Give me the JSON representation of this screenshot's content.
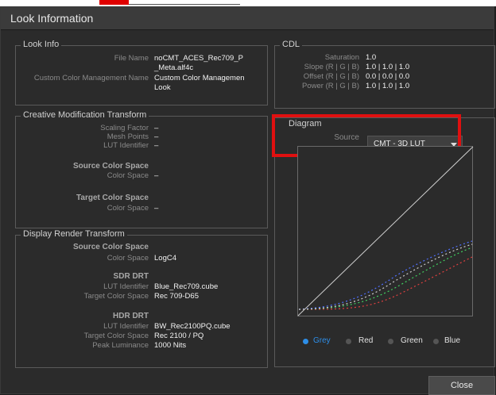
{
  "window_title": "Look Information",
  "look_info": {
    "title": "Look Info",
    "file_name_label": "File Name",
    "file_name_value": "noCMT_ACES_Rec709_P",
    "file_name_value2": "_Meta.alf4c",
    "ccm_label": "Custom Color Management Name",
    "ccm_value": "Custom Color Managemen",
    "ccm_value2": "Look"
  },
  "cmt": {
    "title": "Creative Modification Transform",
    "scaling_label": "Scaling Factor",
    "scaling_value": "–",
    "mesh_label": "Mesh Points",
    "mesh_value": "–",
    "lut_label": "LUT Identifier",
    "lut_value": "–",
    "source_heading": "Source Color Space",
    "source_cs_label": "Color Space",
    "source_cs_value": "–",
    "target_heading": "Target Color Space",
    "target_cs_label": "Color Space",
    "target_cs_value": "–"
  },
  "drt": {
    "title": "Display Render Transform",
    "source_heading": "Source Color Space",
    "source_cs_label": "Color Space",
    "source_cs_value": "LogC4",
    "sdr_heading": "SDR DRT",
    "sdr_lut_label": "LUT Identifier",
    "sdr_lut_value": "Blue_Rec709.cube",
    "sdr_target_label": "Target Color Space",
    "sdr_target_value": "Rec 709-D65",
    "hdr_heading": "HDR DRT",
    "hdr_lut_label": "LUT Identifier",
    "hdr_lut_value": "BW_Rec2100PQ.cube",
    "hdr_target_label": "Target Color Space",
    "hdr_target_value": "Rec 2100 / PQ",
    "peak_label": "Peak Luminance",
    "peak_value": "1000 Nits"
  },
  "cdl": {
    "title": "CDL",
    "saturation_label": "Saturation",
    "saturation_value": "1.0",
    "slope_label": "Slope (R | G | B)",
    "slope_value": "1.0 | 1.0 | 1.0",
    "offset_label": "Offset (R | G | B)",
    "offset_value": "0.0 | 0.0 | 0.0",
    "power_label": "Power (R | G | B)",
    "power_value": "1.0 | 1.0 | 1.0"
  },
  "diagram": {
    "title": "Diagram",
    "source_label": "Source",
    "source_value": "CMT - 3D LUT",
    "radios": [
      "Grey",
      "Red",
      "Green",
      "Blue"
    ],
    "selected": "Grey"
  },
  "close_label": "Close",
  "colors": {
    "accent": "#2d8ee8",
    "highlight": "#e01010",
    "red": "#e04040",
    "green": "#40d060",
    "blue": "#5070ff"
  }
}
